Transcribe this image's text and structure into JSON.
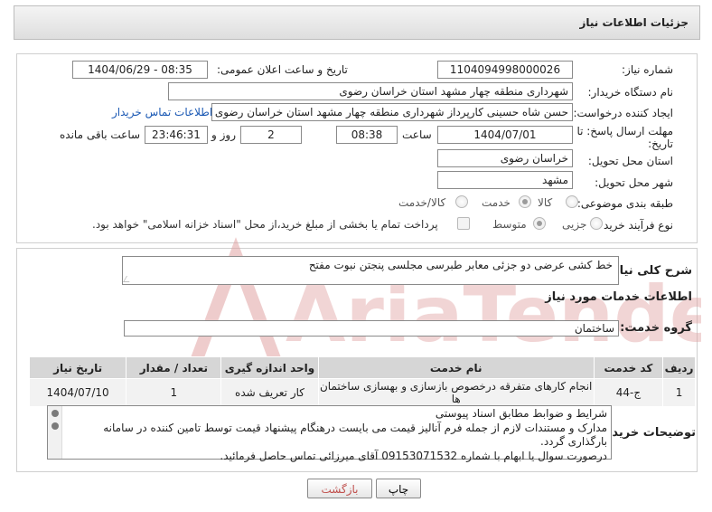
{
  "header": {
    "title": "جزئیات اطلاعات نیاز"
  },
  "form": {
    "need_number_label": "شماره نیاز:",
    "need_number": "1104094998000026",
    "announce_label": "تاریخ و ساعت اعلان عمومی:",
    "announce_value": "1404/06/29 - 08:35",
    "buyer_org_label": "نام دستگاه خریدار:",
    "buyer_org": "شهرداری منطقه چهار مشهد استان خراسان رضوی",
    "creator_label": "ایجاد کننده درخواست:",
    "creator": "حسن شاه حسینی کارپرداز شهرداری منطقه چهار مشهد استان خراسان رضوی",
    "contact_link": "اطلاعات تماس خریدار",
    "deadline_label_1": "مهلت ارسال پاسخ: تا",
    "deadline_label_2": "تاریخ:",
    "deadline_date": "1404/07/01",
    "time_label": "ساعت",
    "deadline_time": "08:38",
    "days_value": "2",
    "days_label": "روز و",
    "remaining_time": "23:46:31",
    "remaining_label": "ساعت باقی مانده",
    "province_label": "استان محل تحویل:",
    "province": "خراسان رضوی",
    "city_label": "شهر محل تحویل:",
    "city": "مشهد",
    "category_label": "طبقه بندی موضوعی:",
    "category_options": {
      "goods": "کالا",
      "service": "خدمت",
      "goods_service": "کالا/خدمت"
    },
    "process_label": "نوع فرآیند خرید :",
    "process_options": {
      "partial": "جزیی",
      "medium": "متوسط"
    },
    "payment_note": "پرداخت تمام یا بخشی از مبلغ خرید،از محل \"اسناد خزانه اسلامی\" خواهد بود."
  },
  "summary": {
    "label": "شرح کلی نیاز:",
    "text": "خط کشی عرضی دو جزئی معابر طبرسی مجلسی پنجتن نبوت مفتح"
  },
  "services": {
    "section_title": "اطلاعات خدمات مورد نیاز",
    "group_label": "گروه خدمت:",
    "group_value": "ساختمان",
    "columns": [
      "ردیف",
      "کد خدمت",
      "نام خدمت",
      "واحد اندازه گیری",
      "تعداد / مقدار",
      "تاریخ نیاز"
    ],
    "rows": [
      [
        "1",
        "ج-44",
        "انجام کارهای متفرقه درخصوص بازسازی و بهسازی ساختمان ها",
        "کار تعریف شده",
        "1",
        "1404/07/10"
      ]
    ]
  },
  "notes": {
    "label": "توضیحات خریدار:",
    "line1": "شرایط و ضوابط مطابق اسناد پیوستی",
    "line2": "مدارک و مستندات لازم از جمله فرم آنالیز قیمت می بایست درهنگام پیشنهاد قیمت توسط تامین کننده در سامانه",
    "line3": "بارگذاری گردد.",
    "line4": "درصورت سوال یا ابهام با شماره 09153071532  آقای میرزائی تماس حاصل فرمائید."
  },
  "buttons": {
    "print": "چاپ",
    "back": "بازگشت"
  },
  "watermark": {
    "text": "AriaTender.net"
  },
  "colors": {
    "link": "#1b59b4",
    "back_text": "#c0504d",
    "watermark": "#e1a3a3"
  }
}
